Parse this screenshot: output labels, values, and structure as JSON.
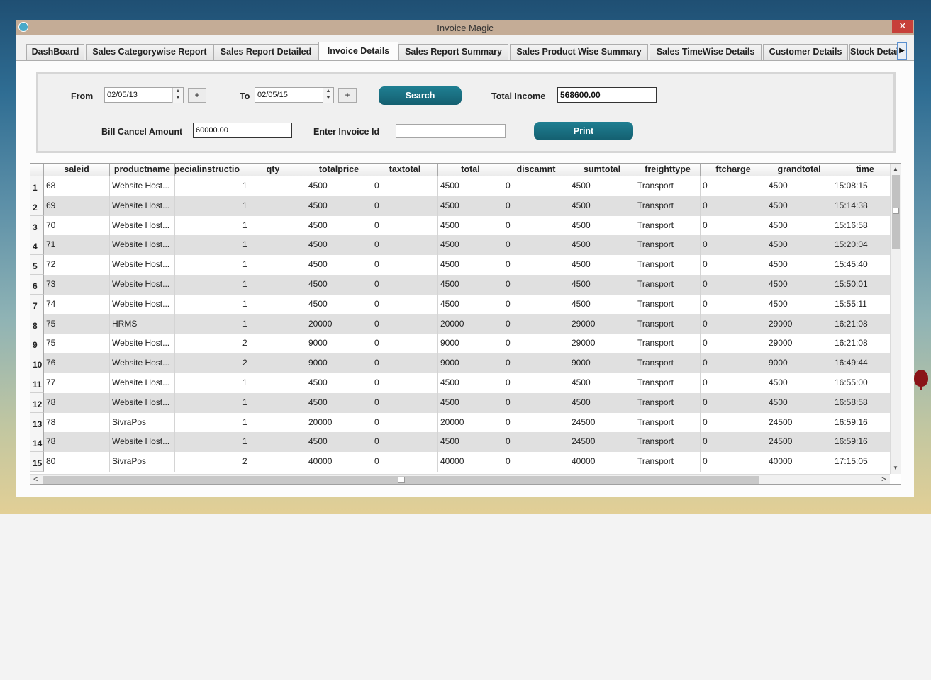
{
  "window": {
    "title": "Invoice Magic",
    "close_glyph": "✕"
  },
  "tabs": [
    {
      "label": "DashBoard",
      "active": false
    },
    {
      "label": "Sales Categorywise Report",
      "active": false
    },
    {
      "label": "Sales Report Detailed",
      "active": false
    },
    {
      "label": "Invoice Details",
      "active": true
    },
    {
      "label": "Sales Report Summary",
      "active": false
    },
    {
      "label": "Sales Product Wise Summary",
      "active": false
    },
    {
      "label": "Sales TimeWise Details",
      "active": false
    },
    {
      "label": "Customer Details",
      "active": false
    },
    {
      "label": "Stock Details",
      "active": false
    }
  ],
  "tab_scroll_glyph": "▶",
  "filters": {
    "from_label": "From",
    "from_value": "02/05/13",
    "to_label": "To",
    "to_value": "02/05/15",
    "plus_glyph": "+",
    "search_label": "Search",
    "total_income_label": "Total Income",
    "total_income_value": "568600.00",
    "bill_cancel_label": "Bill Cancel Amount",
    "bill_cancel_value": "60000.00",
    "invoice_id_label": "Enter  Invoice  Id",
    "invoice_id_value": "",
    "print_label": "Print"
  },
  "grid": {
    "columns": [
      "saleid",
      "productname",
      "specialinstructio",
      "qty",
      "totalprice",
      "taxtotal",
      "total",
      "discamnt",
      "sumtotal",
      "freighttype",
      "ftcharge",
      "grandtotal",
      "time"
    ],
    "rows": [
      [
        "1",
        "68",
        "Website Host...",
        "",
        "1",
        "4500",
        "0",
        "4500",
        "0",
        "4500",
        "Transport",
        "0",
        "4500",
        "15:08:15"
      ],
      [
        "2",
        "69",
        "Website Host...",
        "",
        "1",
        "4500",
        "0",
        "4500",
        "0",
        "4500",
        "Transport",
        "0",
        "4500",
        "15:14:38"
      ],
      [
        "3",
        "70",
        "Website Host...",
        "",
        "1",
        "4500",
        "0",
        "4500",
        "0",
        "4500",
        "Transport",
        "0",
        "4500",
        "15:16:58"
      ],
      [
        "4",
        "71",
        "Website Host...",
        "",
        "1",
        "4500",
        "0",
        "4500",
        "0",
        "4500",
        "Transport",
        "0",
        "4500",
        "15:20:04"
      ],
      [
        "5",
        "72",
        "Website Host...",
        "",
        "1",
        "4500",
        "0",
        "4500",
        "0",
        "4500",
        "Transport",
        "0",
        "4500",
        "15:45:40"
      ],
      [
        "6",
        "73",
        "Website Host...",
        "",
        "1",
        "4500",
        "0",
        "4500",
        "0",
        "4500",
        "Transport",
        "0",
        "4500",
        "15:50:01"
      ],
      [
        "7",
        "74",
        "Website Host...",
        "",
        "1",
        "4500",
        "0",
        "4500",
        "0",
        "4500",
        "Transport",
        "0",
        "4500",
        "15:55:11"
      ],
      [
        "8",
        "75",
        "HRMS",
        "",
        "1",
        "20000",
        "0",
        "20000",
        "0",
        "29000",
        "Transport",
        "0",
        "29000",
        "16:21:08"
      ],
      [
        "9",
        "75",
        "Website Host...",
        "",
        "2",
        "9000",
        "0",
        "9000",
        "0",
        "29000",
        "Transport",
        "0",
        "29000",
        "16:21:08"
      ],
      [
        "10",
        "76",
        "Website Host...",
        "",
        "2",
        "9000",
        "0",
        "9000",
        "0",
        "9000",
        "Transport",
        "0",
        "9000",
        "16:49:44"
      ],
      [
        "11",
        "77",
        "Website Host...",
        "",
        "1",
        "4500",
        "0",
        "4500",
        "0",
        "4500",
        "Transport",
        "0",
        "4500",
        "16:55:00"
      ],
      [
        "12",
        "78",
        "Website Host...",
        "",
        "1",
        "4500",
        "0",
        "4500",
        "0",
        "4500",
        "Transport",
        "0",
        "4500",
        "16:58:58"
      ],
      [
        "13",
        "78",
        "SivraPos",
        "",
        "1",
        "20000",
        "0",
        "20000",
        "0",
        "24500",
        "Transport",
        "0",
        "24500",
        "16:59:16"
      ],
      [
        "14",
        "78",
        "Website Host...",
        "",
        "1",
        "4500",
        "0",
        "4500",
        "0",
        "24500",
        "Transport",
        "0",
        "24500",
        "16:59:16"
      ],
      [
        "15",
        "80",
        "SivraPos",
        "",
        "2",
        "40000",
        "0",
        "40000",
        "0",
        "40000",
        "Transport",
        "0",
        "40000",
        "17:15:05"
      ]
    ]
  },
  "scroll_glyphs": {
    "up": "▲",
    "down": "▼",
    "left": "<",
    "right": ">"
  }
}
